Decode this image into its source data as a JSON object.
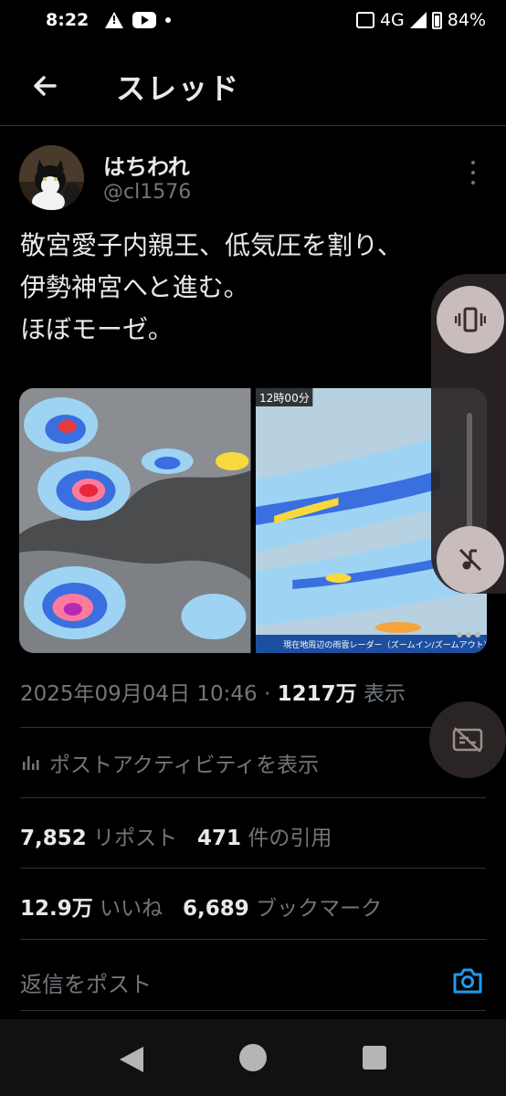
{
  "status_bar": {
    "time": "8:22",
    "network": "4G",
    "battery": "84%"
  },
  "header": {
    "title": "スレッド"
  },
  "tweet": {
    "author_name": "はちわれ",
    "author_handle": "@cl1576",
    "text_lines": [
      "敬宮愛子内親王、低気圧を割り、",
      "伊勢神宮へと進む。",
      "ほぼモーゼ。"
    ],
    "media_caption_time": "12時00分",
    "media_caption_bottom": "現在地周辺の雨雲レーダー（ズームイン/ズームアウト）",
    "timestamp": "2025年09月04日 10:46",
    "separator": "·",
    "views_count": "1217万",
    "views_label": "表示"
  },
  "activity_label": "ポストアクティビティを表示",
  "stats": {
    "reposts_count": "7,852",
    "reposts_label": "リポスト",
    "quotes_count": "471",
    "quotes_label": "件の引用",
    "likes_count": "12.9万",
    "likes_label": "いいね",
    "bookmarks_count": "6,689",
    "bookmarks_label": "ブックマーク"
  },
  "reply": {
    "placeholder": "返信をポスト"
  },
  "colors": {
    "accent": "#1d9bf0",
    "background": "#000000",
    "muted": "#71767b"
  }
}
